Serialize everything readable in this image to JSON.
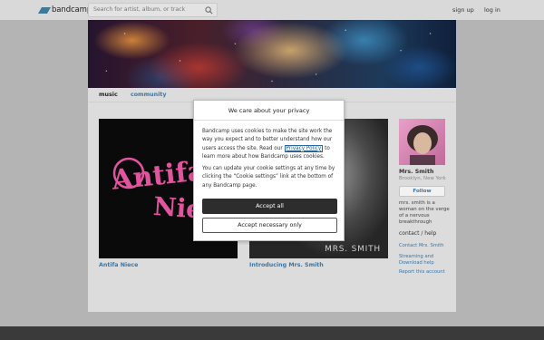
{
  "header": {
    "logo_text": "bandcamp",
    "search_placeholder": "Search for artist, album, or track",
    "signup": "sign up",
    "login": "log in"
  },
  "tabs": {
    "music": "music",
    "community": "community"
  },
  "albums": [
    {
      "title": "Antifa Niece",
      "art_text": "Antifa Niece"
    },
    {
      "title": "Introducing Mrs. Smith",
      "art_text": "MRS. SMITH"
    }
  ],
  "artist": {
    "name": "Mrs. Smith",
    "location": "Brooklyn, New York",
    "follow": "Follow",
    "bio": "mrs. smith is a woman on the verge of a nervous breakthrough",
    "contact_heading": "contact / help",
    "links": [
      "Contact Mrs. Smith",
      "Streaming and Download help",
      "Report this account"
    ]
  },
  "cookie_modal": {
    "title": "We care about your privacy",
    "p1_before": "Bandcamp uses cookies to make the site work the way you expect and to better understand how our users access the site. Read our ",
    "p1_link": "Privacy Policy",
    "p1_after": " to learn more about how Bandcamp uses cookies.",
    "p2": "You can update your cookie settings at any time by clicking the “Cookie settings” link at the bottom of any Bandcamp page.",
    "accept_all": "Accept all",
    "accept_necessary": "Accept necessary only"
  },
  "colors": {
    "link_blue": "#3776a8",
    "logo_blue": "#3e7998",
    "footer": "#3a3a3a"
  }
}
